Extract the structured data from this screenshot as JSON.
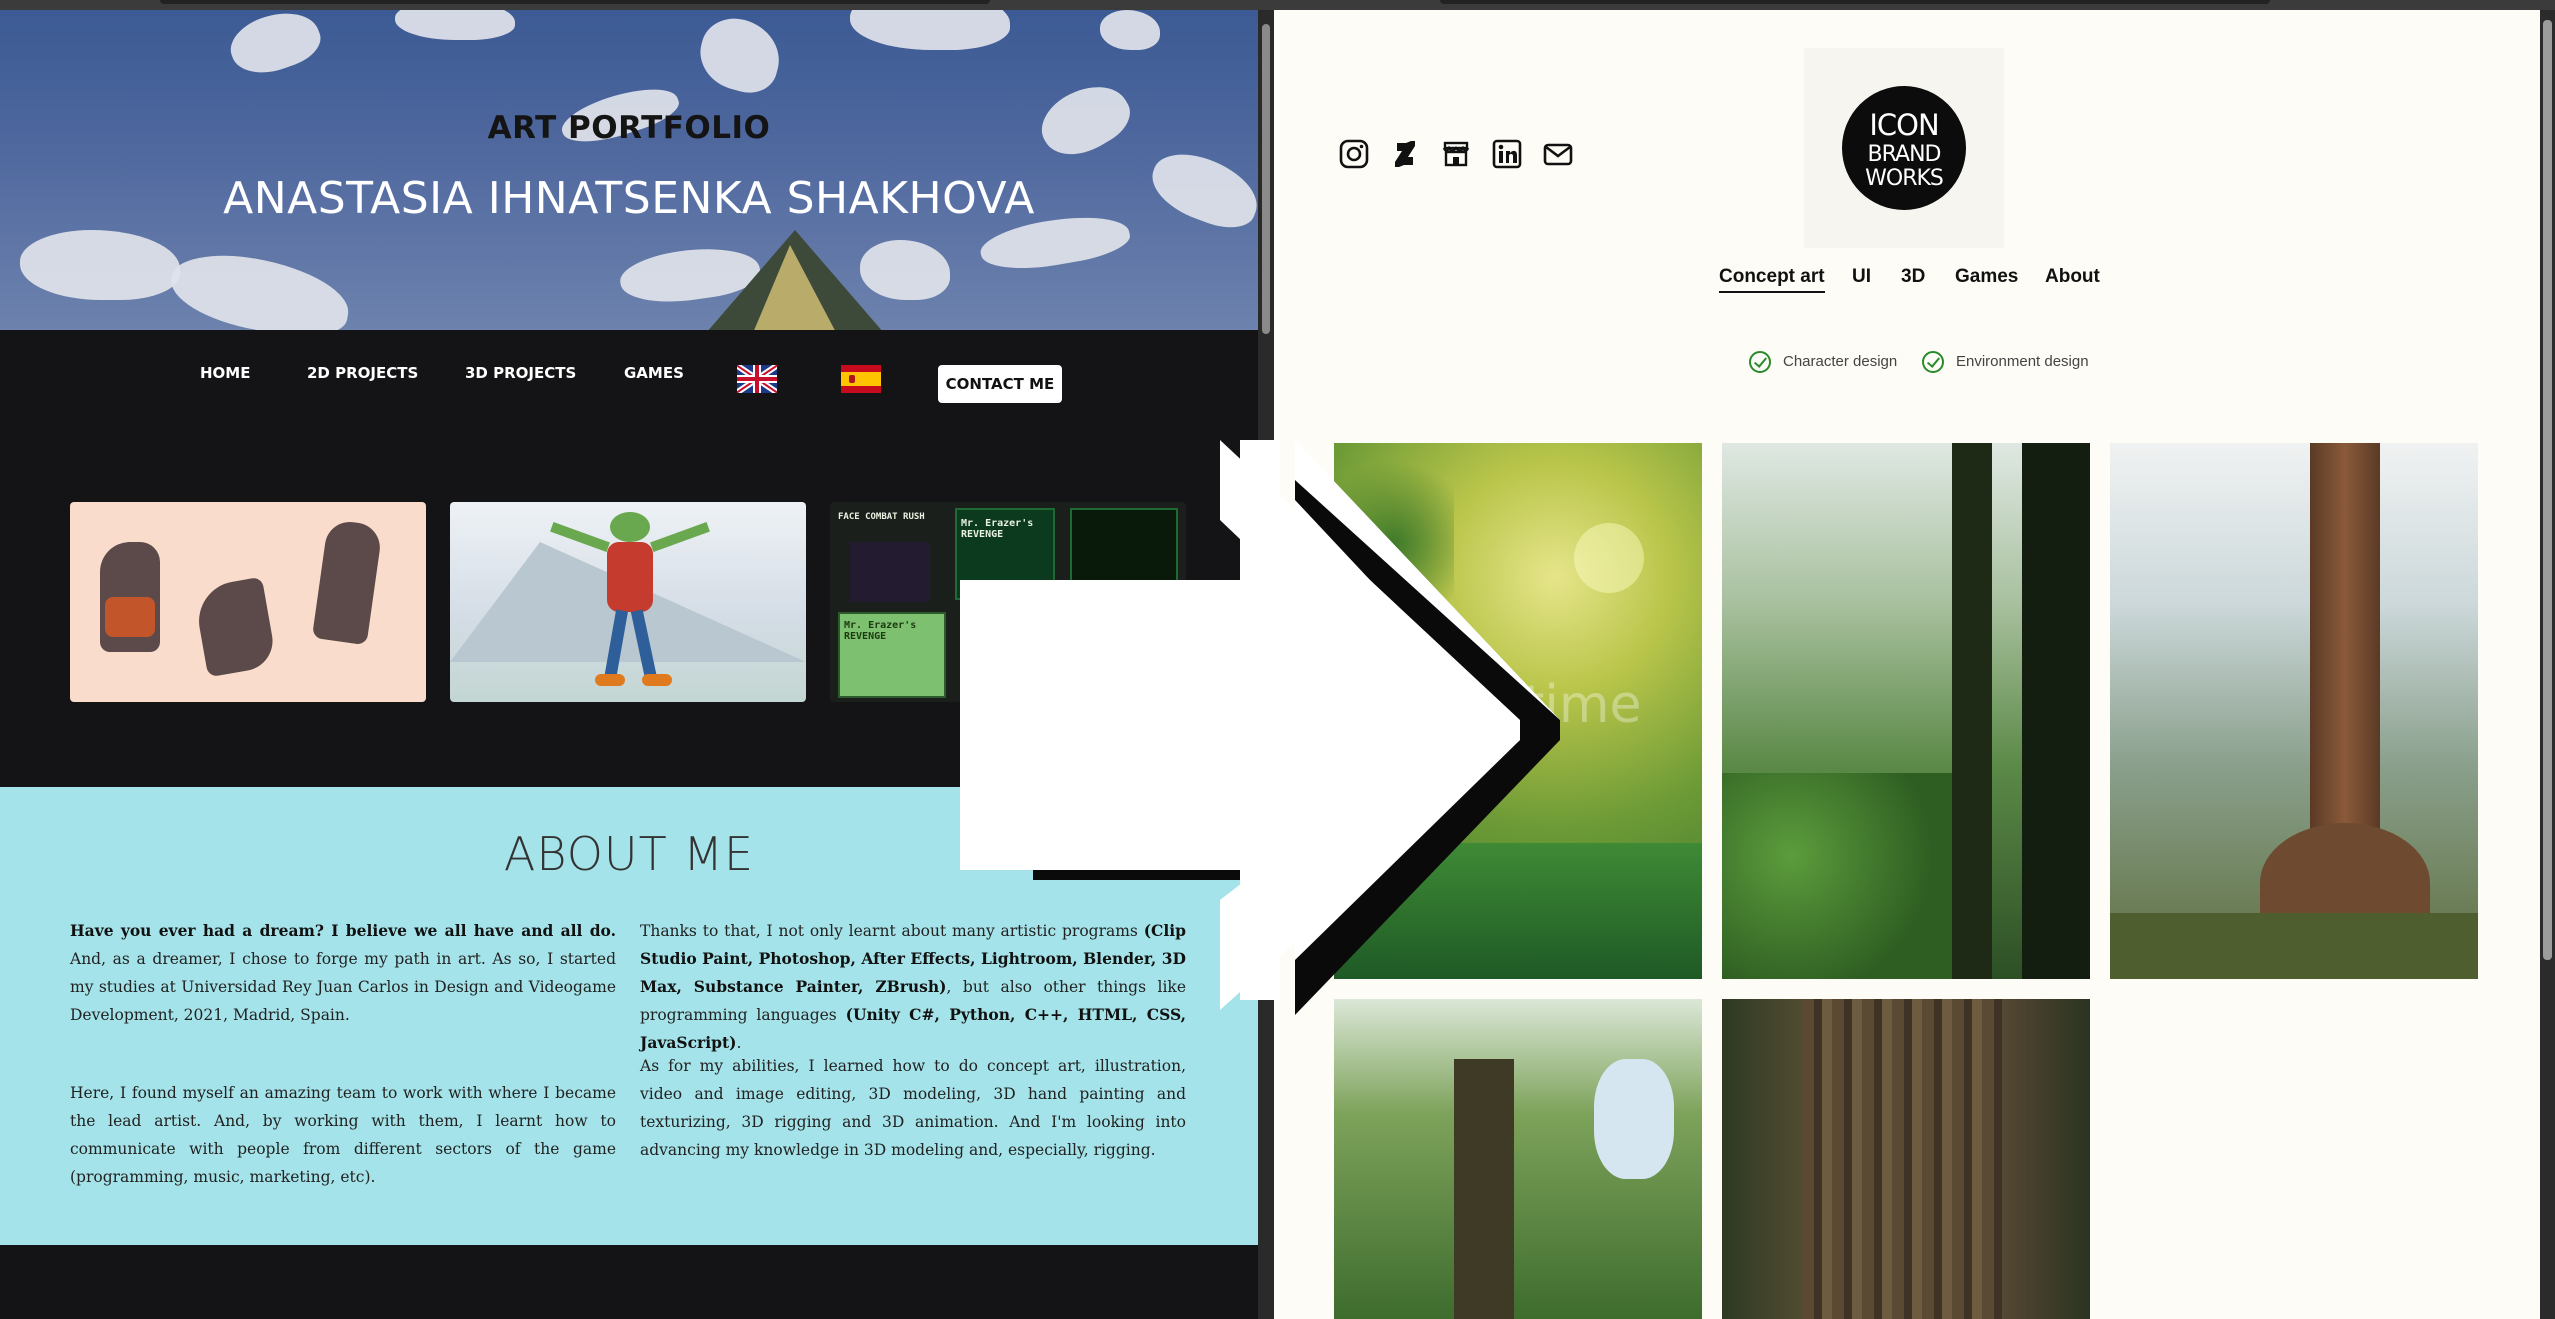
{
  "left_site": {
    "hero": {
      "subtitle": "ART PORTFOLIO",
      "title": "ANASTASIA IHNATSENKA SHAKHOVA"
    },
    "nav": {
      "home": "HOME",
      "projects_2d": "2D PROJECTS",
      "projects_3d": "3D PROJECTS",
      "games": "GAMES",
      "contact": "CONTACT ME",
      "flags": [
        "english-flag",
        "spanish-flag"
      ]
    },
    "thumbnails": {
      "game_title_top": "FACE COMBAT RUSH",
      "game_box_1": "Mr. Erazer's REVENGE",
      "game_box_2": "Mr. Erazer's REVENGE"
    },
    "about": {
      "title": "ABOUT ME",
      "p1_bold": "Have you ever had a dream? I believe we all have and all do.",
      "p1_rest": " And, as a dreamer, I chose to forge my path in art. As so, I started my studies at Universidad Rey Juan Carlos in Design and Videogame Development, 2021, Madrid, Spain.",
      "p2": "Here, I found myself an amazing team to work with where I became the lead artist. And, by working with them, I learnt how to communicate with people from different sectors of the game (programming, music, marketing, etc).",
      "p3_start": "Thanks to that, I not only learnt about many artistic programs ",
      "p3_bold1": "(Clip Studio Paint, Photoshop, After Effects, Lightroom, Blender, 3D Max, Substance Painter, ZBrush)",
      "p3_mid": ", but also other things like programming languages ",
      "p3_bold2": "(Unity C#, Python, C++, HTML, CSS, JavaScript)",
      "p3_end": ".",
      "p4": "As for my abilities, I learned how to do concept art, illustration, video and image editing, 3D modeling, 3D hand painting and texturizing, 3D rigging and 3D animation. And I'm looking into advancing my knowledge in 3D modeling and, especially, rigging."
    }
  },
  "right_site": {
    "social_icons": [
      "instagram-icon",
      "deviantart-icon",
      "store-icon",
      "linkedin-icon",
      "mail-icon"
    ],
    "logo": {
      "line1": "ICON",
      "line2": "BRAND",
      "line3": "WORKS"
    },
    "nav": {
      "concept_art": "Concept art",
      "ui": "UI",
      "three_d": "3D",
      "games": "Games",
      "about": "About"
    },
    "filters": {
      "character": "Character design",
      "environment": "Environment design"
    },
    "gallery_watermark": "time"
  },
  "colors": {
    "about_bg": "#a4e3e9",
    "dark_bg": "#141416",
    "right_bg": "#fdfcf6",
    "filter_check": "#2a8a2a"
  }
}
